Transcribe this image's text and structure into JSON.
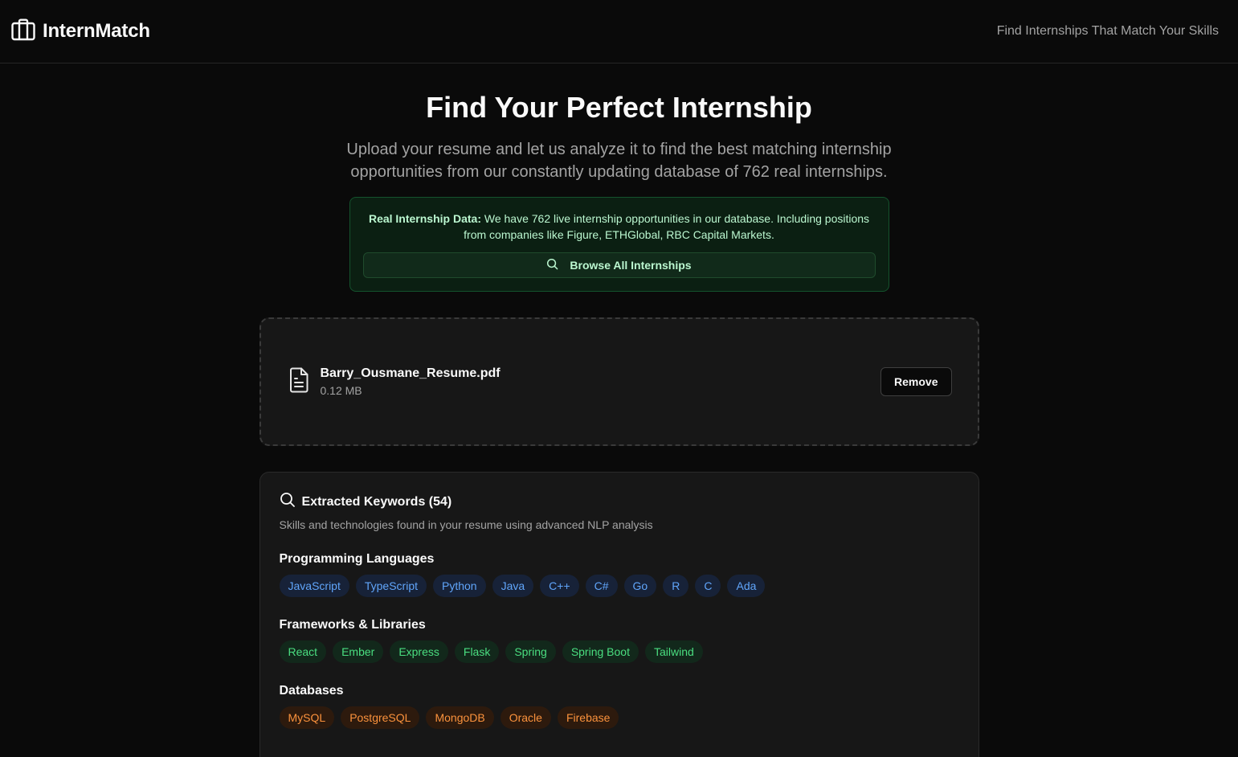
{
  "header": {
    "brand": "InternMatch",
    "brand_icon": "briefcase-icon",
    "tagline": "Find Internships That Match Your Skills"
  },
  "hero": {
    "title": "Find Your Perfect Internship",
    "subtitle": "Upload your resume and let us analyze it to find the best matching internship opportunities from our constantly updating database of 762 real internships."
  },
  "notice": {
    "label": "Real Internship Data:",
    "text": " We have 762 live internship opportunities in our database. Including positions from companies like Figure, ETHGlobal, RBC Capital Markets.",
    "browse_label": "Browse All Internships",
    "browse_icon": "search-icon"
  },
  "upload": {
    "file_icon": "file-text-icon",
    "file_name": "Barry_Ousmane_Resume.pdf",
    "file_size": "0.12 MB",
    "remove_label": "Remove"
  },
  "keywords": {
    "icon": "search-icon",
    "title": "Extracted Keywords (54)",
    "subtitle": "Skills and technologies found in your resume using advanced NLP analysis",
    "categories": [
      {
        "name": "Programming Languages",
        "color": "blue",
        "tags": [
          "JavaScript",
          "TypeScript",
          "Python",
          "Java",
          "C++",
          "C#",
          "Go",
          "R",
          "C",
          "Ada"
        ]
      },
      {
        "name": "Frameworks & Libraries",
        "color": "green",
        "tags": [
          "React",
          "Ember",
          "Express",
          "Flask",
          "Spring",
          "Spring Boot",
          "Tailwind"
        ]
      },
      {
        "name": "Databases",
        "color": "orange",
        "tags": [
          "MySQL",
          "PostgreSQL",
          "MongoDB",
          "Oracle",
          "Firebase"
        ]
      }
    ]
  },
  "colors": {
    "background": "#0a0a0a",
    "card": "#171717",
    "notice_bg": "#0b1f12",
    "notice_text": "#bbf7d0",
    "tag_blue": "#60a5fa",
    "tag_green": "#4ade80",
    "tag_orange": "#fb923c"
  }
}
